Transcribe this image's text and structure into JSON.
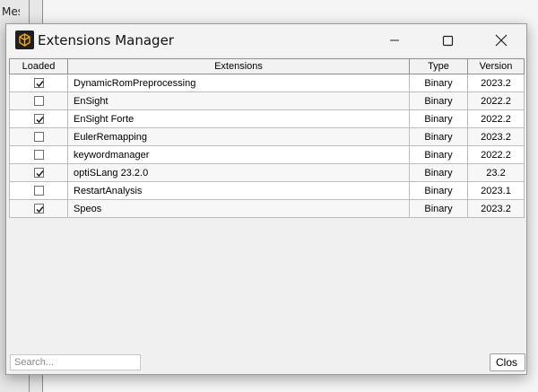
{
  "background": {
    "text": "Mes"
  },
  "window": {
    "title": "Extensions Manager",
    "icon": "ansys-logo-icon",
    "accent": "#f2a71b"
  },
  "table": {
    "headers": [
      "Loaded",
      "Extensions",
      "Type",
      "Version"
    ],
    "rows": [
      {
        "loaded": true,
        "name": "DynamicRomPreprocessing",
        "type": "Binary",
        "version": "2023.2"
      },
      {
        "loaded": false,
        "name": "EnSight",
        "type": "Binary",
        "version": "2022.2"
      },
      {
        "loaded": true,
        "name": "EnSight Forte",
        "type": "Binary",
        "version": "2022.2"
      },
      {
        "loaded": false,
        "name": "EulerRemapping",
        "type": "Binary",
        "version": "2023.2"
      },
      {
        "loaded": false,
        "name": "keywordmanager",
        "type": "Binary",
        "version": "2022.2"
      },
      {
        "loaded": true,
        "name": "optiSLang 23.2.0",
        "type": "Binary",
        "version": "23.2"
      },
      {
        "loaded": false,
        "name": "RestartAnalysis",
        "type": "Binary",
        "version": "2023.1"
      },
      {
        "loaded": true,
        "name": "Speos",
        "type": "Binary",
        "version": "2023.2"
      }
    ]
  },
  "search": {
    "placeholder": "Search..."
  },
  "buttons": {
    "close": "Clos"
  }
}
